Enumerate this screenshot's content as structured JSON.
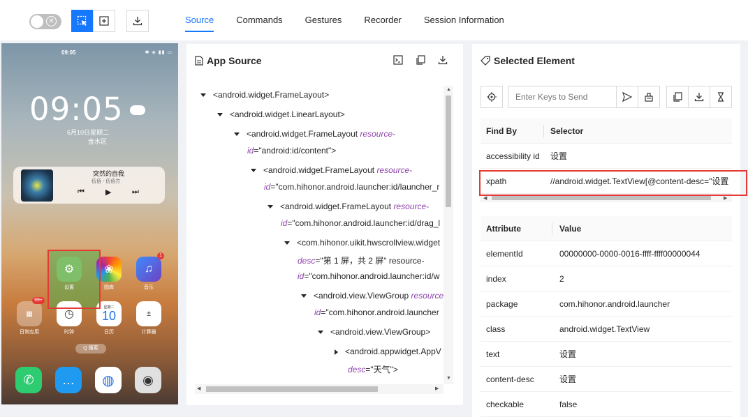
{
  "toolbar": {
    "tabs": [
      {
        "label": "Source",
        "active": true
      },
      {
        "label": "Commands",
        "active": false
      },
      {
        "label": "Gestures",
        "active": false
      },
      {
        "label": "Recorder",
        "active": false
      },
      {
        "label": "Session Information",
        "active": false
      }
    ],
    "accent_color": "#1677ff"
  },
  "phone": {
    "status_time": "09:05",
    "clock": "09:05",
    "date": "6月10日星期二",
    "location": "金水区",
    "music": {
      "song": "突然的自我",
      "artist": "伍佰 - 伍佰方"
    },
    "apps": [
      {
        "name": "设置",
        "icon": "settings-icon"
      },
      {
        "name": "图库",
        "icon": "gallery-icon"
      },
      {
        "name": "音乐",
        "icon": "music-icon",
        "badge": "1"
      },
      {
        "name": "日常应用",
        "icon": "folder-icon",
        "badge": "99+"
      },
      {
        "name": "时钟",
        "icon": "clock-icon"
      },
      {
        "name": "日历",
        "icon": "calendar-icon",
        "calendar_day": "10",
        "calendar_weekday": "星期二"
      },
      {
        "name": "计算器",
        "icon": "calculator-icon"
      }
    ],
    "search_label": "Q 搜索"
  },
  "source_panel": {
    "title": "App Source",
    "tree": [
      {
        "caret": "down",
        "pre": "<android.widget.FrameLayout>",
        "attr": "",
        "post": ""
      },
      {
        "caret": "down",
        "pre": "<android.widget.LinearLayout>",
        "attr": "",
        "post": ""
      },
      {
        "caret": "down",
        "pre": "<android.widget.FrameLayout ",
        "attr": "resource-",
        "post": ""
      },
      {
        "caret": "",
        "pre": "",
        "attr": "id",
        "post": "=\"android:id/content\">"
      },
      {
        "caret": "down",
        "pre": "<android.widget.FrameLayout ",
        "attr": "resource-",
        "post": ""
      },
      {
        "caret": "",
        "pre": "",
        "attr": "id",
        "post": "=\"com.hihonor.android.launcher:id/launcher_r"
      },
      {
        "caret": "down",
        "pre": "<android.widget.FrameLayout ",
        "attr": "resource-",
        "post": ""
      },
      {
        "caret": "",
        "pre": "",
        "attr": "id",
        "post": "=\"com.hihonor.android.launcher:id/drag_l"
      },
      {
        "caret": "down",
        "pre": "<com.hihonor.uikit.hwscrollview.widget",
        "attr": "",
        "post": ""
      },
      {
        "caret": "",
        "pre": "",
        "attr": "desc",
        "post": "=\"第 1 屏，共 2 屏\" resource-"
      },
      {
        "caret": "",
        "pre": "",
        "attr": "id",
        "post": "=\"com.hihonor.android.launcher:id/w"
      },
      {
        "caret": "down",
        "pre": "<android.view.ViewGroup ",
        "attr": "resource",
        "post": ""
      },
      {
        "caret": "",
        "pre": "",
        "attr": "id",
        "post": "=\"com.hihonor.android.launcher"
      },
      {
        "caret": "down",
        "pre": "<android.view.ViewGroup>",
        "attr": "",
        "post": ""
      },
      {
        "caret": "right",
        "pre": "<android.appwidget.AppV",
        "attr": "",
        "post": ""
      },
      {
        "caret": "",
        "pre": "",
        "attr": "desc",
        "post": "=\"天气\">"
      }
    ]
  },
  "selected_panel": {
    "title": "Selected Element",
    "keys_placeholder": "Enter Keys to Send",
    "selector_headers": {
      "find_by": "Find By",
      "selector": "Selector"
    },
    "selectors": [
      {
        "find_by": "accessibility id",
        "selector": "设置"
      },
      {
        "find_by": "xpath",
        "selector": "//android.widget.TextView[@content-desc=\"设置"
      }
    ],
    "attr_headers": {
      "attribute": "Attribute",
      "value": "Value"
    },
    "attributes": [
      {
        "name": "elementId",
        "value": "00000000-0000-0016-ffff-ffff00000044"
      },
      {
        "name": "index",
        "value": "2"
      },
      {
        "name": "package",
        "value": "com.hihonor.android.launcher"
      },
      {
        "name": "class",
        "value": "android.widget.TextView"
      },
      {
        "name": "text",
        "value": "设置"
      },
      {
        "name": "content-desc",
        "value": "设置"
      },
      {
        "name": "checkable",
        "value": "false"
      }
    ]
  }
}
